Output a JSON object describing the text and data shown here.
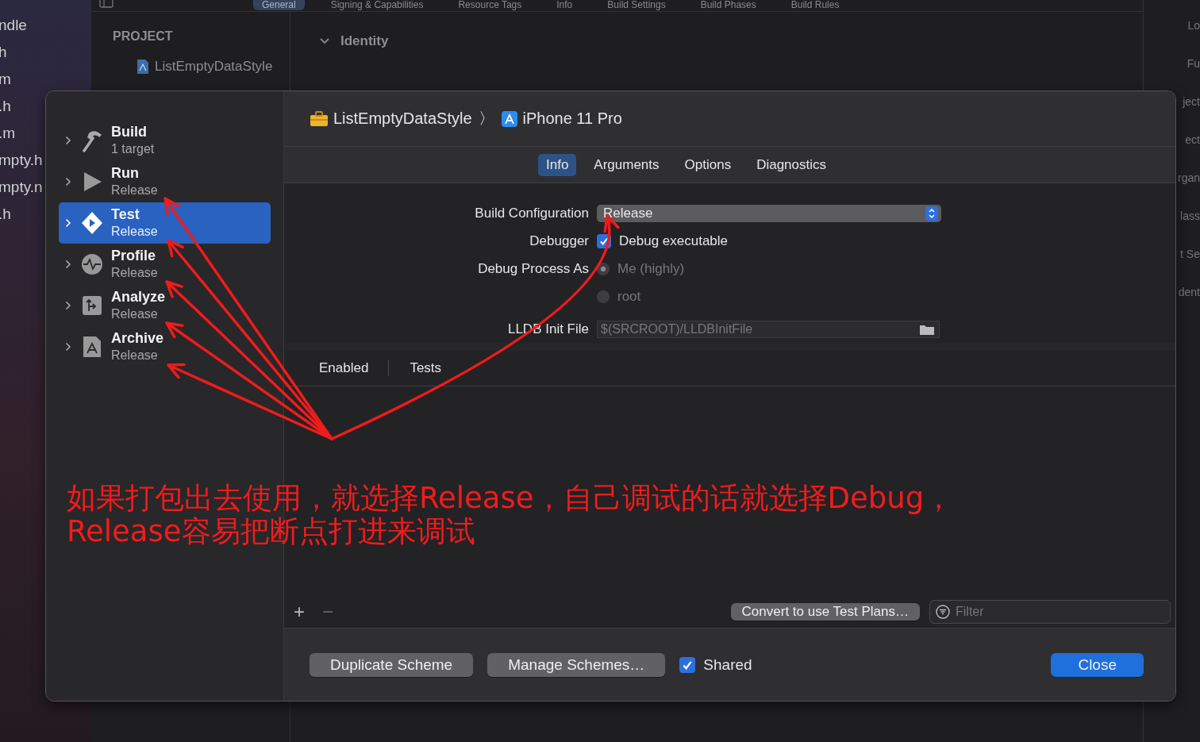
{
  "background": {
    "file_list": [
      "ndle",
      "h",
      "m",
      ".h",
      ".m",
      "mpty.h",
      "mpty.n",
      ".h"
    ],
    "editor_tabs": [
      {
        "label": "General",
        "selected": true
      },
      {
        "label": "Signing & Capabilities",
        "selected": false
      },
      {
        "label": "Resource Tags",
        "selected": false
      },
      {
        "label": "Info",
        "selected": false
      },
      {
        "label": "Build Settings",
        "selected": false
      },
      {
        "label": "Build Phases",
        "selected": false
      },
      {
        "label": "Build Rules",
        "selected": false
      }
    ],
    "project_header": "PROJECT",
    "project_item": "ListEmptyDataStyle",
    "section": "Identity",
    "inspector_fragments": [
      "Lo",
      "Fu",
      "ject",
      "ect",
      "rgan",
      "lass",
      "t Se",
      "dent"
    ]
  },
  "dialog": {
    "actions": [
      {
        "name": "Build",
        "subtitle": "1 target",
        "kind": "build",
        "selected": false
      },
      {
        "name": "Run",
        "subtitle": "Release",
        "kind": "run",
        "selected": false
      },
      {
        "name": "Test",
        "subtitle": "Release",
        "kind": "test",
        "selected": true
      },
      {
        "name": "Profile",
        "subtitle": "Release",
        "kind": "profile",
        "selected": false
      },
      {
        "name": "Analyze",
        "subtitle": "Release",
        "kind": "analyze",
        "selected": false
      },
      {
        "name": "Archive",
        "subtitle": "Release",
        "kind": "archive",
        "selected": false
      }
    ],
    "breadcrumb": {
      "project": "ListEmptyDataStyle",
      "separator": "〉",
      "device": "iPhone 11 Pro"
    },
    "tabs": [
      {
        "label": "Info",
        "selected": true
      },
      {
        "label": "Arguments",
        "selected": false
      },
      {
        "label": "Options",
        "selected": false
      },
      {
        "label": "Diagnostics",
        "selected": false
      }
    ],
    "form": {
      "build_configuration": {
        "label": "Build Configuration",
        "value": "Release"
      },
      "debugger": {
        "label": "Debugger",
        "checkbox_label": "Debug executable",
        "checked": true
      },
      "debug_process_as": {
        "label": "Debug Process As",
        "options": [
          {
            "label": "Me (highly)",
            "selected": true,
            "disabled": true
          },
          {
            "label": "root",
            "selected": false,
            "disabled": true
          }
        ]
      },
      "lldb_init_file": {
        "label": "LLDB Init File",
        "placeholder": "$(SRCROOT)/LLDBInitFile"
      }
    },
    "tests_table": {
      "columns": [
        "Enabled",
        "Tests"
      ]
    },
    "table_controls": {
      "add": "+",
      "remove": "−"
    },
    "convert_button": "Convert to use Test Plans…",
    "filter": {
      "placeholder": "Filter"
    },
    "footer": {
      "duplicate": "Duplicate Scheme",
      "manage": "Manage Schemes…",
      "shared": {
        "label": "Shared",
        "checked": true
      },
      "close": "Close"
    }
  },
  "annotation": {
    "lines": [
      "如果打包出去使用，就选择Release，自己调试的话就选择Debug，",
      "Release容易把断点打进来调试"
    ]
  }
}
